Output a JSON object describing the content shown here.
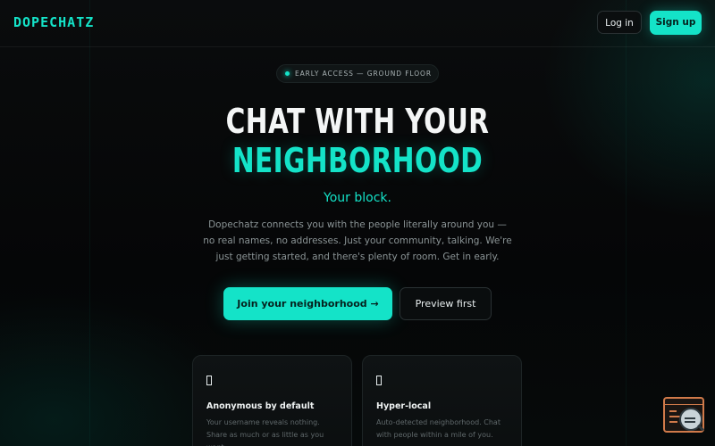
{
  "header": {
    "logo": "DOPECHATZ",
    "login_label": "Log in",
    "signup_label": "Sign up"
  },
  "hero": {
    "badge": "EARLY ACCESS — GROUND FLOOR",
    "title_line1": "CHAT WITH YOUR",
    "title_line2": "NEIGHBORHOOD",
    "tagline": "Your block.",
    "description": "Dopechatz connects you with the people literally around you — no real names, no addresses. Just your community, talking. We're just getting started, and there's plenty of room. Get in early.",
    "primary_cta": "Join your neighborhood →",
    "secondary_cta": "Preview first"
  },
  "features": [
    {
      "icon": "square-glyph-icon",
      "title": "Anonymous by default",
      "text": "Your username reveals nothing. Share as much or as little as you want."
    },
    {
      "icon": "square-glyph-icon",
      "title": "Hyper-local",
      "text": "Auto-detected neighborhood. Chat with people within a mile of you."
    }
  ],
  "colors": {
    "accent": "#14e3c8",
    "background": "#050607",
    "widget": "#d07a4a"
  }
}
